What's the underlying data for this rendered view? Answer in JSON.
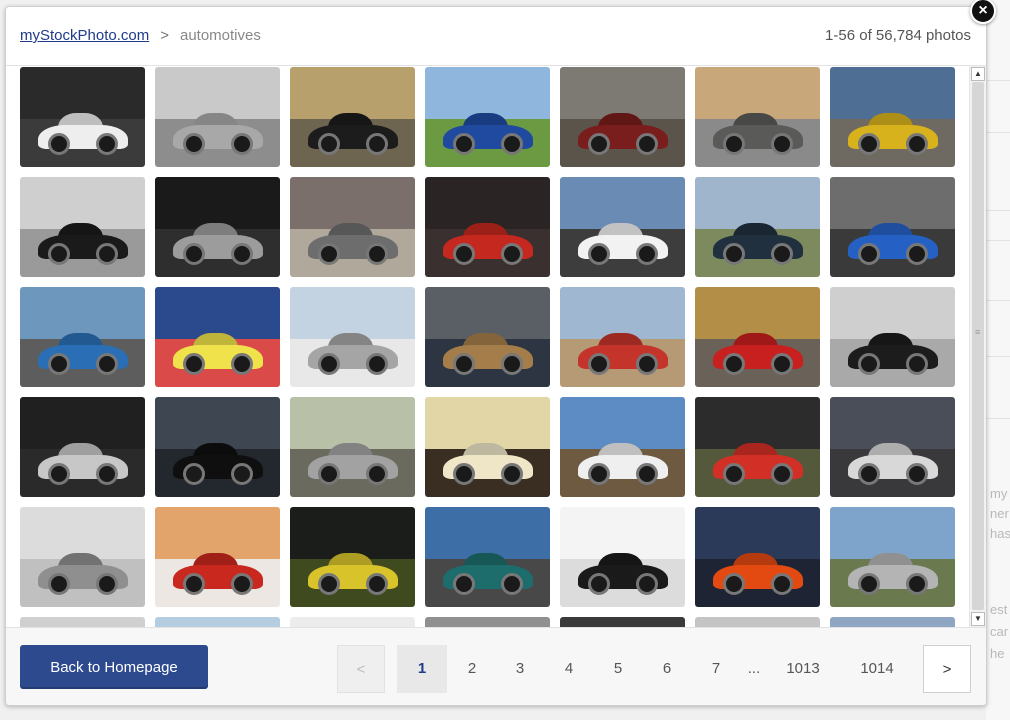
{
  "breadcrumb": {
    "site": "myStockPhoto.com",
    "separator": ">",
    "current": "automotives"
  },
  "result_count": "1-56 of 56,784 photos",
  "close_icon": "×",
  "footer": {
    "back_label": "Back to Homepage"
  },
  "pagination": {
    "prev_label": "<",
    "next_label": ">",
    "ellipsis": "...",
    "pages": [
      "1",
      "2",
      "3",
      "4",
      "5",
      "6",
      "7",
      "1013",
      "1014"
    ],
    "current_page": "1"
  },
  "background_fragments": [
    "my",
    "ner",
    "has",
    "est",
    "car",
    "he"
  ],
  "icons": {
    "close": "close-icon",
    "scroll_up": "arrow-up-icon",
    "scroll_down": "arrow-down-icon",
    "grip": "scroll-grip-icon"
  },
  "colors": {
    "primary_button": "#2d4a8f",
    "link": "#1f3b8a",
    "current_page_bg": "#e8e8e8"
  },
  "thumbnails": [
    {
      "name": "white-hatchback",
      "sky": "#2a2a2a",
      "ground": "#3b3b3b",
      "body": "#eeeeee"
    },
    {
      "name": "silver-supercar-closeup",
      "sky": "#c9c9c9",
      "ground": "#8d8d8d",
      "body": "#a8a8a8"
    },
    {
      "name": "vintage-black-car",
      "sky": "#b7a06b",
      "ground": "#6e6550",
      "body": "#1c1c1c"
    },
    {
      "name": "blue-suv",
      "sky": "#8fb6dd",
      "ground": "#6b9a42",
      "body": "#1f4aa0"
    },
    {
      "name": "red-volvo-sedan",
      "sky": "#7d7a74",
      "ground": "#5a544a",
      "body": "#7a1d1d"
    },
    {
      "name": "grey-hummer",
      "sky": "#c8a87a",
      "ground": "#8a8a8a",
      "body": "#5a5a58"
    },
    {
      "name": "yellow-jeep-offroad",
      "sky": "#4f6e94",
      "ground": "#6e6a62",
      "body": "#d8b21c"
    },
    {
      "name": "black-coupe-desert",
      "sky": "#cfcfcf",
      "ground": "#9a9a9a",
      "body": "#1a1a1a"
    },
    {
      "name": "audi-r8-silver",
      "sky": "#1a1a1a",
      "ground": "#2e2e2e",
      "body": "#9c9c9c"
    },
    {
      "name": "art-deco-silver-car",
      "sky": "#7a6f6a",
      "ground": "#b0a89a",
      "body": "#6d6d6d"
    },
    {
      "name": "f1-mclaren-showroom",
      "sky": "#2a2424",
      "ground": "#3a3030",
      "body": "#c4281e"
    },
    {
      "name": "white-supercars-trees",
      "sky": "#6a8bb4",
      "ground": "#3d3d3d",
      "body": "#f2f2f2"
    },
    {
      "name": "vintage-blue-truck",
      "sky": "#9eb5cc",
      "ground": "#7c8a5e",
      "body": "#20303e"
    },
    {
      "name": "blue-slk-roadster",
      "sky": "#6d6d6d",
      "ground": "#3a3a3a",
      "body": "#2561c4"
    },
    {
      "name": "blue-pickup-truck",
      "sky": "#6e97bd",
      "ground": "#5d5d5d",
      "body": "#2a6fb5"
    },
    {
      "name": "motogp-rider",
      "sky": "#2b4a8e",
      "ground": "#d94a48",
      "body": "#f0e24a"
    },
    {
      "name": "slr-gullwing-silver",
      "sky": "#c3d3e2",
      "ground": "#e8e8e8",
      "body": "#a5a5a5"
    },
    {
      "name": "bronze-sedan-building",
      "sky": "#5a5f66",
      "ground": "#2d3542",
      "body": "#a47d4a"
    },
    {
      "name": "suvs-offroad-dust",
      "sky": "#9fb7d0",
      "ground": "#b69a76",
      "body": "#c4342a"
    },
    {
      "name": "red-bmw-road",
      "sky": "#b38e46",
      "ground": "#6a6258",
      "body": "#c81f1f"
    },
    {
      "name": "black-cadillac-suvs",
      "sky": "#cfcfcf",
      "ground": "#a9a9a9",
      "body": "#1c1c1c"
    },
    {
      "name": "mercedes-slr-chrome",
      "sky": "#202020",
      "ground": "#2a2a2a",
      "body": "#c7c7c7"
    },
    {
      "name": "black-car-garage",
      "sky": "#3e4652",
      "ground": "#23272e",
      "body": "#0f0f0f"
    },
    {
      "name": "silver-slr-road",
      "sky": "#b8c1a8",
      "ground": "#6a6a5e",
      "body": "#a2a2a2"
    },
    {
      "name": "cream-sports-car-closeup",
      "sky": "#e3d6a6",
      "ground": "#3a2e22",
      "body": "#efe6c8"
    },
    {
      "name": "classic-white-sedan",
      "sky": "#5d8bc4",
      "ground": "#6e5a40",
      "body": "#efefef"
    },
    {
      "name": "f1-cars-track",
      "sky": "#2c2c2c",
      "ground": "#55593c",
      "body": "#d22f26"
    },
    {
      "name": "truck-trailer-storm",
      "sky": "#4a4e58",
      "ground": "#39393b",
      "body": "#d8d8d8"
    },
    {
      "name": "silver-gullwing-concept",
      "sky": "#dcdcdc",
      "ground": "#c0c0c0",
      "body": "#8f8f8f"
    },
    {
      "name": "red-hummer-h1",
      "sky": "#e2a46a",
      "ground": "#ece7e2",
      "body": "#c8281e"
    },
    {
      "name": "tractor-pull-night",
      "sky": "#1b1d1a",
      "ground": "#3f4a1f",
      "body": "#d8c42a"
    },
    {
      "name": "green-semi-truck",
      "sky": "#3d6fa6",
      "ground": "#484848",
      "body": "#1d6d6c"
    },
    {
      "name": "black-race-car-white",
      "sky": "#f4f4f4",
      "ground": "#dcdcdc",
      "body": "#1a1a1a"
    },
    {
      "name": "orange-sports-coupe",
      "sky": "#2b3a58",
      "ground": "#1e2434",
      "body": "#e24a12"
    },
    {
      "name": "silver-suv-road",
      "sky": "#7ea4cc",
      "ground": "#6a7a4e",
      "body": "#b4b4b4"
    },
    {
      "name": "partial-1",
      "sky": "#d0d0d0",
      "ground": "#aaaaaa",
      "body": "#777777"
    },
    {
      "name": "partial-2",
      "sky": "#b5cde0",
      "ground": "#e0e0e0",
      "body": "#999999"
    },
    {
      "name": "partial-3",
      "sky": "#ececec",
      "ground": "#cccccc",
      "body": "#888888"
    },
    {
      "name": "partial-4",
      "sky": "#909090",
      "ground": "#5a5a5a",
      "body": "#444444"
    },
    {
      "name": "partial-5",
      "sky": "#3a3a3a",
      "ground": "#2a2a2a",
      "body": "#666666"
    },
    {
      "name": "partial-6",
      "sky": "#c4c4c4",
      "ground": "#9a9a9a",
      "body": "#555555"
    },
    {
      "name": "partial-7",
      "sky": "#8ea6c2",
      "ground": "#667788",
      "body": "#555555"
    }
  ]
}
